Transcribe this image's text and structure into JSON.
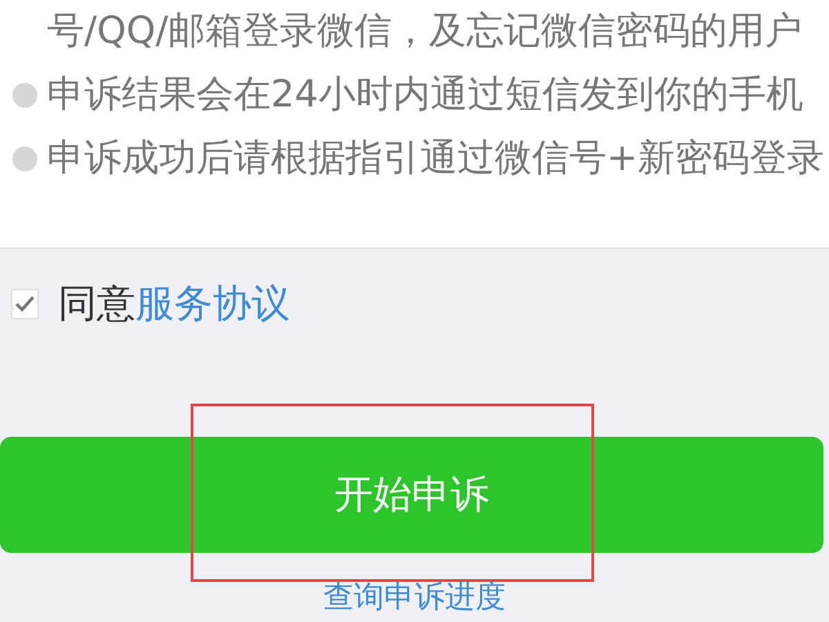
{
  "notes": [
    {
      "text": "号/QQ/邮箱登录微信，及忘记微信密码的用户",
      "bullet": false
    },
    {
      "text": "申诉结果会在24小时内通过短信发到你的手机",
      "bullet": true
    },
    {
      "text": "申诉成功后请根据指引通过微信号+新密码登录",
      "bullet": true
    }
  ],
  "agreement": {
    "checked": true,
    "label": "同意",
    "link": "服务协议"
  },
  "start_button": {
    "label": "开始申诉",
    "highlighted": true
  },
  "progress_link": "查询申诉进度"
}
